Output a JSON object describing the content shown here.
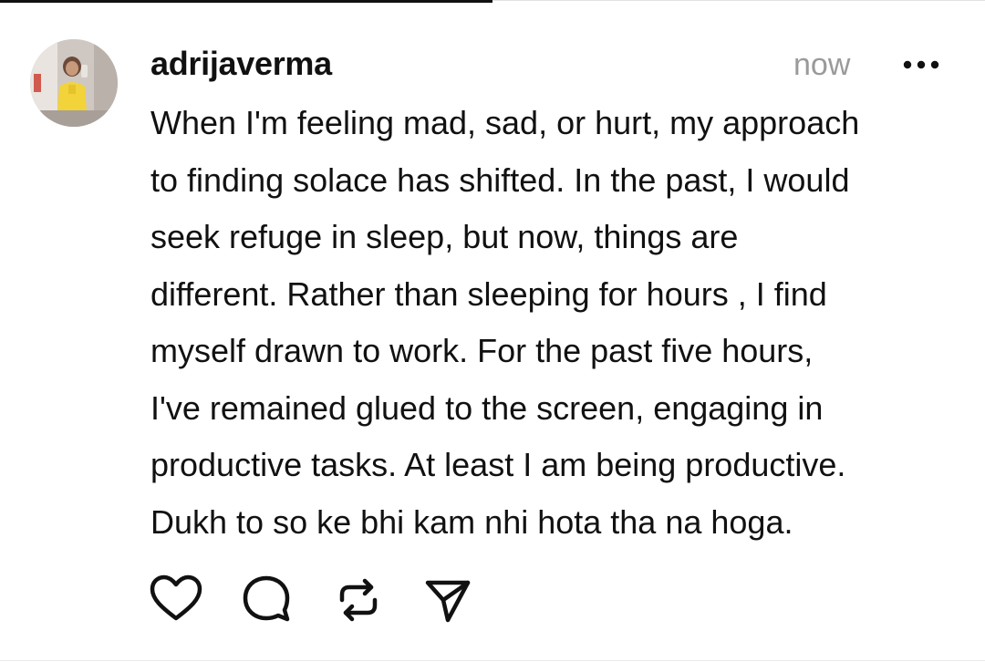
{
  "post": {
    "username": "adrijaverma",
    "timestamp": "now",
    "more_icon": "more-horizontal-icon",
    "text_lines": [
      "When I'm feeling mad, sad, or hurt, my approach",
      "to finding solace has shifted. In the past, I would",
      "seek refuge in sleep, but now, things are",
      "different. Rather than sleeping for hours , I find",
      "myself drawn to work. For the past five hours,",
      "I've remained glued to the screen, engaging in",
      "productive tasks. At least I am being productive.",
      "Dukh to so ke bhi kam nhi hota tha na hoga."
    ]
  },
  "actions": {
    "like_icon": "heart-icon",
    "reply_icon": "comment-bubble-icon",
    "repost_icon": "repost-icon",
    "share_icon": "send-icon"
  },
  "colors": {
    "text": "#111111",
    "muted": "#9a9a9a",
    "background": "#ffffff"
  }
}
